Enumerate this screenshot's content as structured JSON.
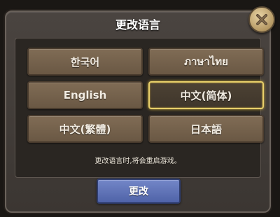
{
  "dialog": {
    "title": "更改语言",
    "close_icon": "close-icon",
    "languages": [
      {
        "label": "한국어",
        "selected": false
      },
      {
        "label": "ภาษาไทย",
        "selected": false
      },
      {
        "label": "English",
        "selected": false
      },
      {
        "label": "中文(简体)",
        "selected": true
      },
      {
        "label": "中文(繁體)",
        "selected": false
      },
      {
        "label": "日本語",
        "selected": false
      }
    ],
    "notice": "更改语言时,将会重启游戏。",
    "confirm_label": "更改"
  },
  "colors": {
    "selected_border": "#e7cf6a",
    "confirm_button": "#5b6fb5",
    "lang_button": "#766350"
  }
}
